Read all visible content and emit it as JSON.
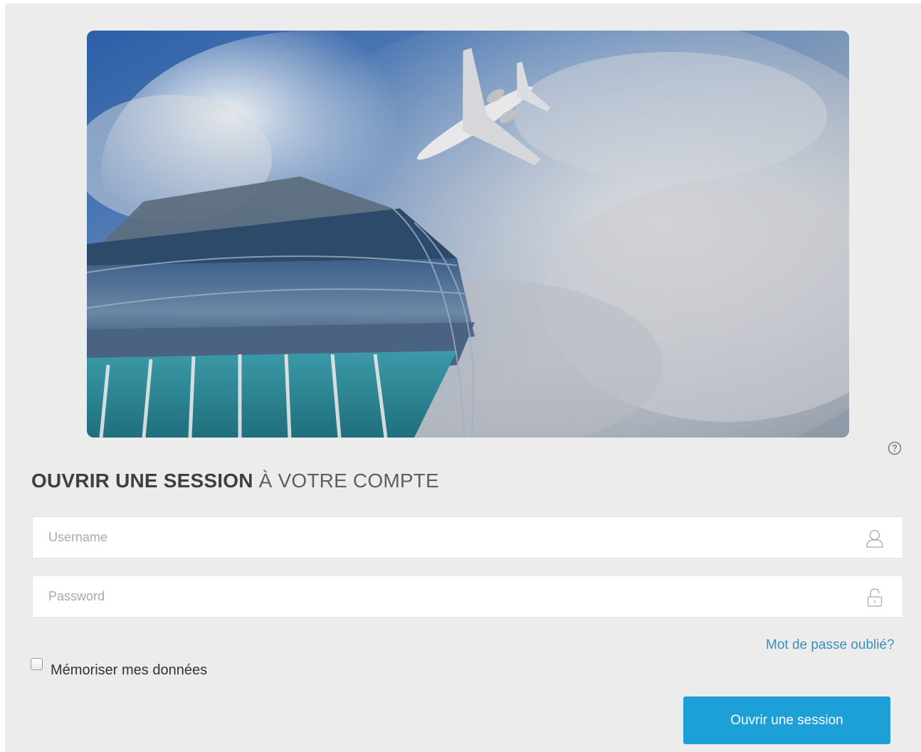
{
  "login": {
    "title_strong": "OUVRIR UNE SESSION",
    "title_light": "À VOTRE COMPTE",
    "username_placeholder": "Username",
    "password_placeholder": "Password",
    "forgot_password": "Mot de passe oublié?",
    "remember_me": "Mémoriser mes données",
    "submit_label": "Ouvrir une session"
  },
  "icons": {
    "help": "help-circle-icon",
    "username": "user-icon",
    "password": "lock-icon"
  },
  "colors": {
    "page_background": "#ececec",
    "accent": "#1ca0d7",
    "link": "#3d8fb8"
  }
}
